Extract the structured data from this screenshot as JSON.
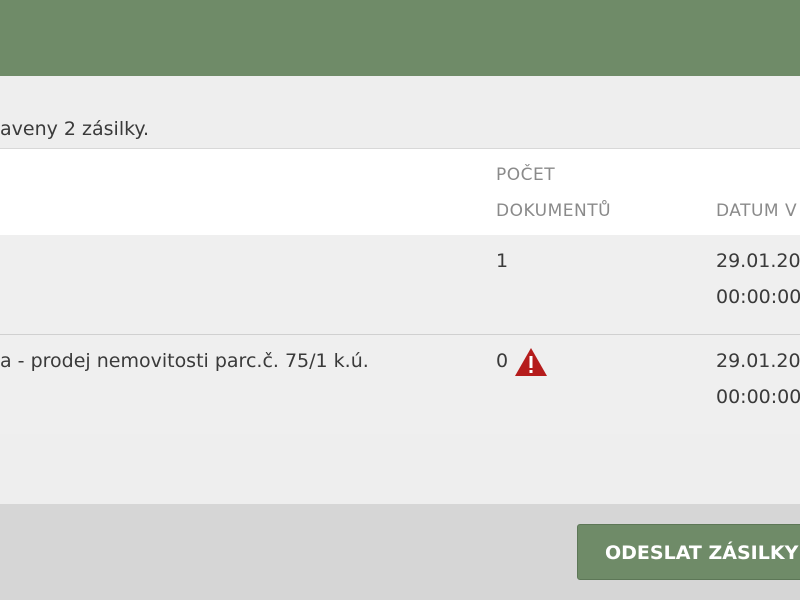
{
  "header": {
    "accent_color": "#6f8b68"
  },
  "panel": {
    "info_text": "aveny 2 zásilky."
  },
  "table": {
    "columns": {
      "count": [
        "POČET",
        "DOKUMENTŮ"
      ],
      "date": [
        "DATUM V"
      ]
    },
    "rows": [
      {
        "subject": "",
        "count": "1",
        "date_line1": "29.01.20",
        "date_line2": "00:00:00",
        "warning": false
      },
      {
        "subject": "a - prodej nemovitosti parc.č. 75/1 k.ú.",
        "count": "0",
        "date_line1": "29.01.20",
        "date_line2": "00:00:00",
        "warning": true,
        "warning_icon": "warning-triangle-icon",
        "warning_color": "#b51c1c"
      }
    ]
  },
  "footer": {
    "send_button_label": "ODESLAT ZÁSILKY"
  }
}
